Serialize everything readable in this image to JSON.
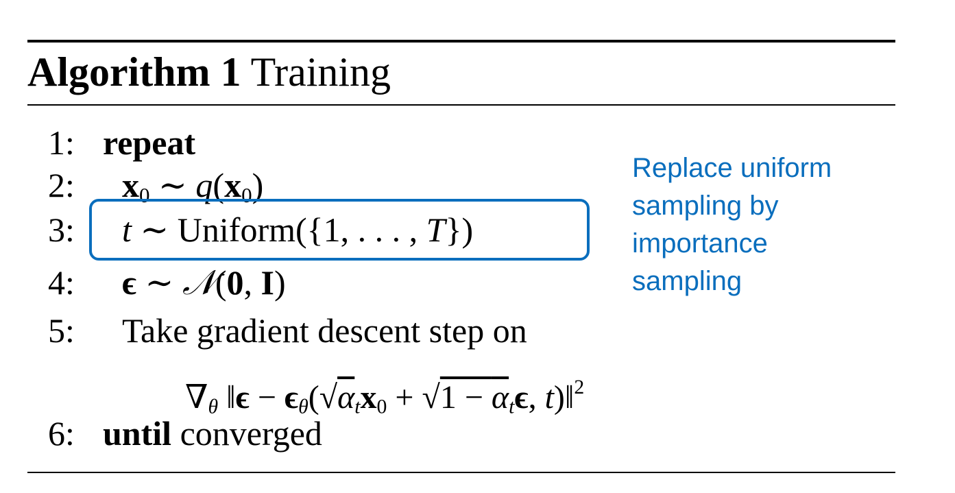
{
  "algorithm": {
    "label": "Algorithm 1",
    "title": "Training"
  },
  "lines": [
    {
      "num": "1:",
      "keyword": "repeat",
      "text": ""
    },
    {
      "num": "2:",
      "text": "x₀ ∼ q(x₀)"
    },
    {
      "num": "3:",
      "text": "t ∼ Uniform({1, . . . , T})"
    },
    {
      "num": "4:",
      "text": "ϵ ∼ 𝒩(0, I)"
    },
    {
      "num": "5:",
      "text": "Take gradient descent step on"
    },
    {
      "num": "",
      "text": "∇θ ‖ϵ − ϵθ(√āt x₀ + √1 − āt ϵ, t)‖²"
    },
    {
      "num": "6:",
      "keyword": "until",
      "text": "converged"
    }
  ],
  "annotation": {
    "lines": [
      "Replace uniform",
      "sampling by",
      "importance",
      "sampling"
    ],
    "color": "#0a6ebd"
  }
}
